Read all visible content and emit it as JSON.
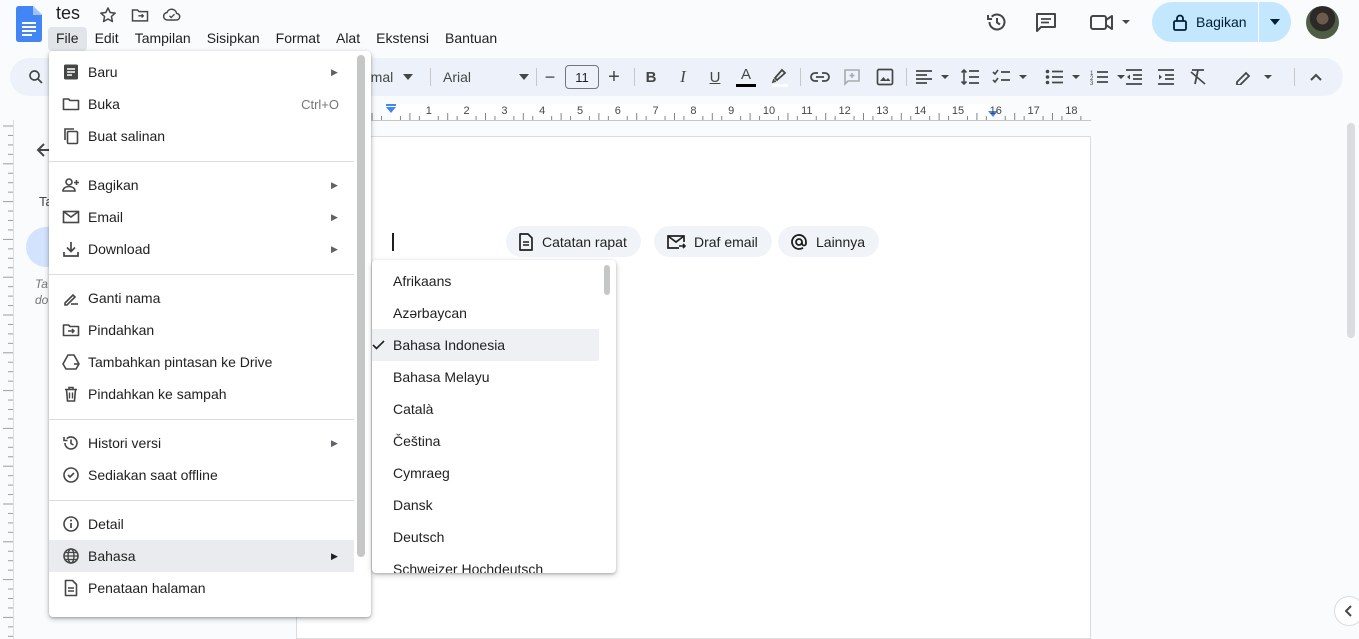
{
  "app": {
    "doc_title": "tes"
  },
  "menubar": [
    "File",
    "Edit",
    "Tampilan",
    "Sisipkan",
    "Format",
    "Alat",
    "Ekstensi",
    "Bantuan"
  ],
  "share": {
    "label": "Bagikan"
  },
  "toolbar": {
    "style_partial": "rmal",
    "font": "Arial",
    "font_size": "11",
    "decrease": "−",
    "increase": "+"
  },
  "ruler_numbers": [
    "1",
    "2",
    "3",
    "4",
    "5",
    "6",
    "7",
    "8",
    "9",
    "10",
    "11",
    "12",
    "13",
    "14",
    "15",
    "16",
    "17",
    "18"
  ],
  "smart_chips": [
    "Catatan rapat",
    "Draf email",
    "Lainnya"
  ],
  "outline": {
    "tab_partial": "Ta",
    "hint_line1": "Ta",
    "hint_line2": "do"
  },
  "file_menu": {
    "groups": [
      [
        {
          "label": "Baru",
          "icon": "new-doc-icon",
          "submenu": true
        },
        {
          "label": "Buka",
          "icon": "folder-icon",
          "shortcut": "Ctrl+O"
        },
        {
          "label": "Buat salinan",
          "icon": "copy-icon"
        }
      ],
      [
        {
          "label": "Bagikan",
          "icon": "person-add-icon",
          "submenu": true
        },
        {
          "label": "Email",
          "icon": "mail-icon",
          "submenu": true
        },
        {
          "label": "Download",
          "icon": "download-icon",
          "submenu": true
        }
      ],
      [
        {
          "label": "Ganti nama",
          "icon": "rename-icon"
        },
        {
          "label": "Pindahkan",
          "icon": "move-folder-icon"
        },
        {
          "label": "Tambahkan pintasan ke Drive",
          "icon": "drive-shortcut-icon"
        },
        {
          "label": "Pindahkan ke sampah",
          "icon": "trash-icon"
        }
      ],
      [
        {
          "label": "Histori versi",
          "icon": "history-icon",
          "submenu": true
        },
        {
          "label": "Sediakan saat offline",
          "icon": "offline-icon"
        }
      ],
      [
        {
          "label": "Detail",
          "icon": "info-icon"
        },
        {
          "label": "Bahasa",
          "icon": "globe-icon",
          "submenu": true,
          "highlighted": true
        },
        {
          "label": "Penataan halaman",
          "icon": "page-setup-icon"
        }
      ]
    ]
  },
  "language_menu": {
    "items": [
      "Afrikaans",
      "Azərbaycan",
      "Bahasa Indonesia",
      "Bahasa Melayu",
      "Català",
      "Čeština",
      "Cymraeg",
      "Dansk",
      "Deutsch",
      "Schweizer Hochdeutsch"
    ],
    "selected": "Bahasa Indonesia"
  },
  "colors": {
    "accent": "#0b57d0",
    "share_bg": "#c2e7ff",
    "toolbar_bg": "#edf2fa",
    "page_bg": "#f9fbfd"
  }
}
